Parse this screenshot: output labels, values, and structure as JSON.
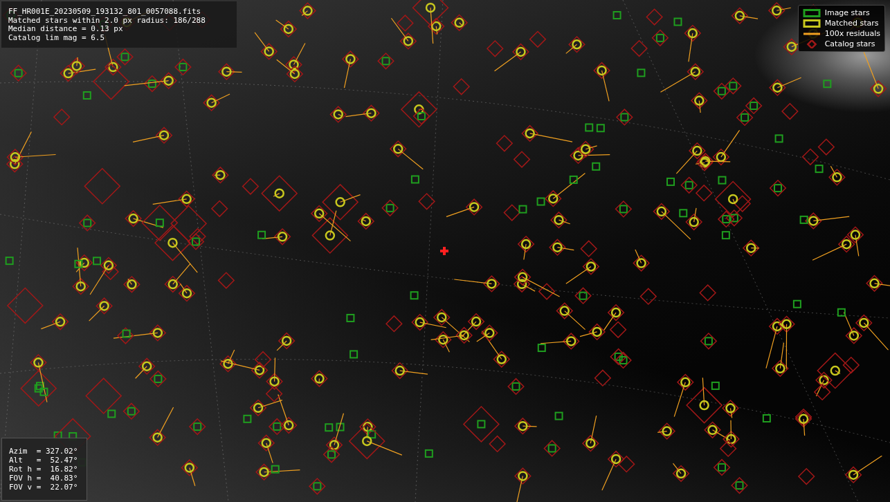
{
  "info": {
    "lines": [
      "FF_HR001E_20230509_193132_801_0057088.fits",
      "Matched stars within 2.0 px radius: 186/288",
      "Median distance = 0.13 px",
      "Catalog lim mag = 6.5"
    ]
  },
  "legend": [
    {
      "kind": "box",
      "label": "Image stars",
      "color": "#1f9e1f"
    },
    {
      "kind": "box",
      "label": "Matched stars",
      "color": "#c8c81e"
    },
    {
      "kind": "line",
      "label": "100x residuals",
      "color": "#f0a020"
    },
    {
      "kind": "diamond",
      "label": "Catalog stars",
      "color": "#a01818"
    }
  ],
  "pointing": {
    "lines": [
      "Azim  = 327.02°",
      "Alt   =  52.47°",
      "Rot h =  16.82°",
      "FOV h =  40.83°",
      "FOV v =  22.07°"
    ]
  }
}
